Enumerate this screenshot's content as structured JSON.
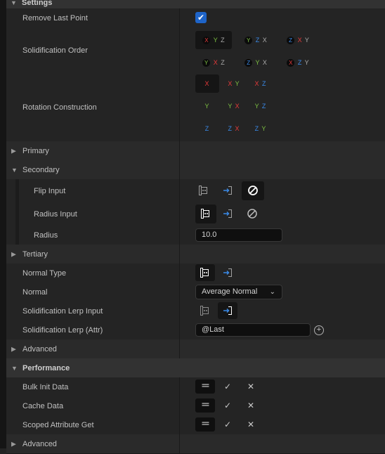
{
  "top_category": {
    "label": "Settings"
  },
  "remove_last_point": {
    "label": "Remove Last Point",
    "checked": true,
    "check_glyph": "✔"
  },
  "solidification_order": {
    "label": "Solidification Order",
    "options": [
      {
        "text": "X Y Z",
        "a": "X",
        "b": "Y",
        "c": "Z",
        "selected": true
      },
      {
        "text": "Y Z X",
        "a": "Y",
        "b": "Z",
        "c": "X",
        "selected": false
      },
      {
        "text": "Z X Y",
        "a": "Z",
        "b": "X",
        "c": "Y",
        "selected": false
      },
      {
        "text": "Y X Z",
        "a": "Y",
        "b": "X",
        "c": "Z",
        "selected": false
      },
      {
        "text": "Z Y X",
        "a": "Z",
        "b": "Y",
        "c": "X",
        "selected": false
      },
      {
        "text": "X Z Y",
        "a": "X",
        "b": "Z",
        "c": "Y",
        "selected": false
      }
    ]
  },
  "rotation_construction": {
    "label": "Rotation Construction",
    "options": [
      "X",
      "X Y",
      "X Z",
      "Y",
      "Y X",
      "Y Z",
      "Z",
      "Z X",
      "Z Y"
    ],
    "selected_index": 0
  },
  "primary": {
    "label": "Primary",
    "expanded": false
  },
  "secondary": {
    "label": "Secondary",
    "expanded": true,
    "flip_input": {
      "label": "Flip Input",
      "selected_mode": "disabled"
    },
    "radius_input": {
      "label": "Radius Input",
      "selected_mode": "constant"
    },
    "radius": {
      "label": "Radius",
      "value": "10.0"
    }
  },
  "tertiary": {
    "label": "Tertiary",
    "expanded": false
  },
  "normal_type": {
    "label": "Normal Type",
    "selected_mode": "constant"
  },
  "normal": {
    "label": "Normal",
    "value": "Average Normal",
    "chevron": "⌄"
  },
  "lerp_input": {
    "label": "Solidification Lerp Input",
    "selected_mode": "attribute"
  },
  "lerp_attr": {
    "label": "Solidification Lerp (Attr)",
    "value": "@Last",
    "plus": "+"
  },
  "advanced_1": {
    "label": "Advanced",
    "expanded": false
  },
  "performance": {
    "label": "Performance",
    "expanded": true,
    "rows": [
      {
        "label": "Bulk Init Data",
        "default": "==",
        "on": "✓",
        "off": "✕",
        "selected": "default"
      },
      {
        "label": "Cache Data",
        "default": "==",
        "on": "✓",
        "off": "✕",
        "selected": "default"
      },
      {
        "label": "Scoped Attribute Get",
        "default": "==",
        "on": "✓",
        "off": "✕",
        "selected": "default"
      }
    ]
  },
  "advanced_2": {
    "label": "Advanced",
    "expanded": false
  },
  "colors": {
    "x_axis": "#e83a3a",
    "y_axis": "#7dc142",
    "z_axis": "#3a8ae8",
    "checkbox": "#1e64c8"
  }
}
